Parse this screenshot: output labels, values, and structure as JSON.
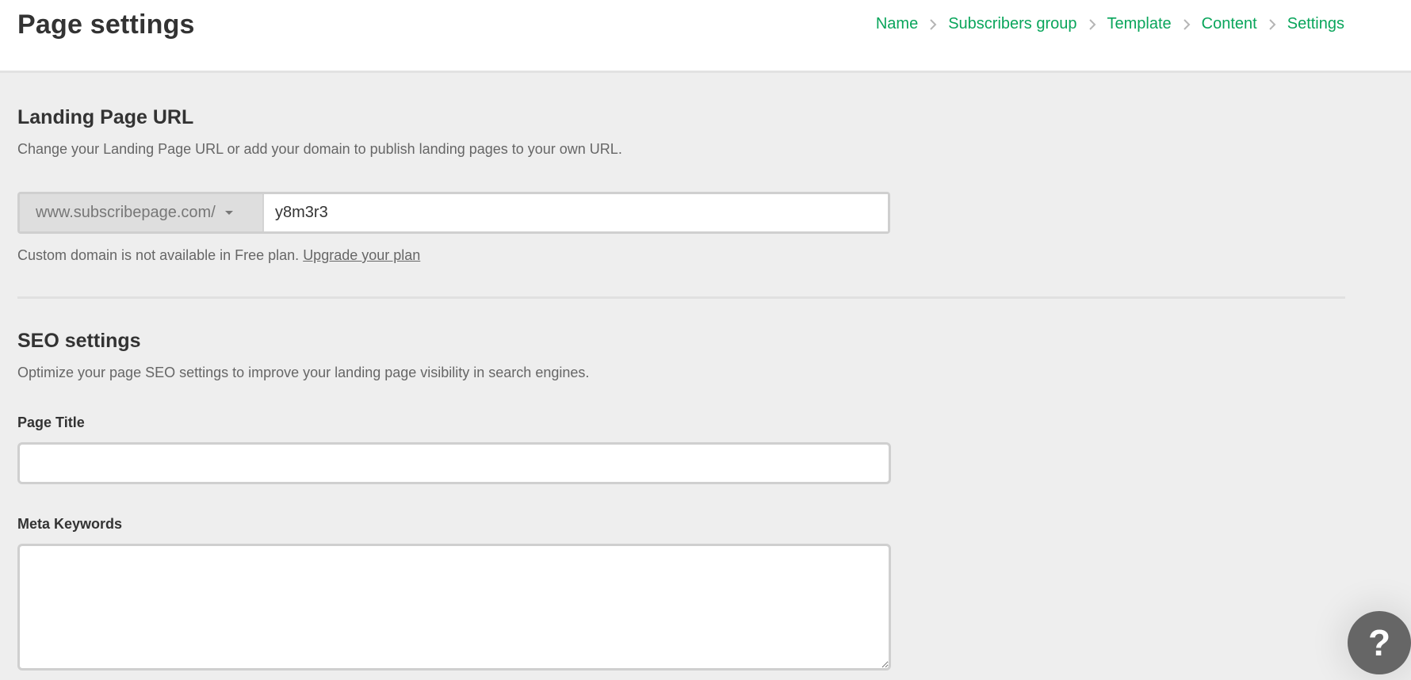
{
  "header": {
    "title": "Page settings",
    "breadcrumb": [
      {
        "label": "Name"
      },
      {
        "label": "Subscribers group"
      },
      {
        "label": "Template"
      },
      {
        "label": "Content"
      },
      {
        "label": "Settings"
      }
    ]
  },
  "landing_url": {
    "title": "Landing Page URL",
    "description": "Change your Landing Page URL or add your domain to publish landing pages to your own URL.",
    "domain_selected": "www.subscribepage.com/",
    "slug_value": "y8m3r3",
    "note_text": "Custom domain is not available in Free plan. ",
    "upgrade_link": "Upgrade your plan"
  },
  "seo": {
    "title": "SEO settings",
    "description": "Optimize your page SEO settings to improve your landing page visibility in search engines.",
    "page_title_label": "Page Title",
    "page_title_value": "",
    "meta_keywords_label": "Meta Keywords",
    "meta_keywords_value": ""
  },
  "help": {
    "glyph": "?",
    "icon": "question-mark-icon"
  },
  "colors": {
    "accent": "#09a55b",
    "background": "#eeeeee",
    "help_button": "#666666"
  }
}
